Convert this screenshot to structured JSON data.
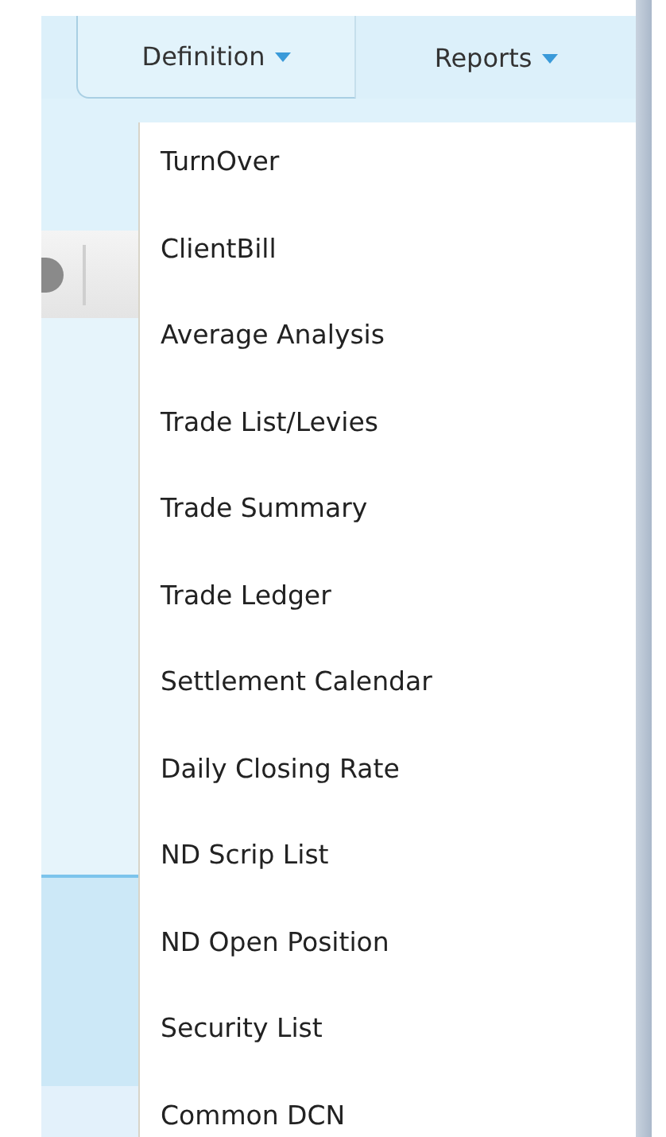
{
  "tabs": [
    {
      "label": "Definition",
      "selected": true
    },
    {
      "label": "Reports",
      "selected": false
    }
  ],
  "menu": {
    "items": [
      "TurnOver",
      "ClientBill",
      "Average Analysis",
      "Trade List/Levies",
      "Trade Summary",
      "Trade Ledger",
      "Settlement Calendar",
      "Daily Closing Rate",
      "ND Scrip List",
      "ND Open Position",
      "Security List",
      "Common DCN"
    ]
  }
}
